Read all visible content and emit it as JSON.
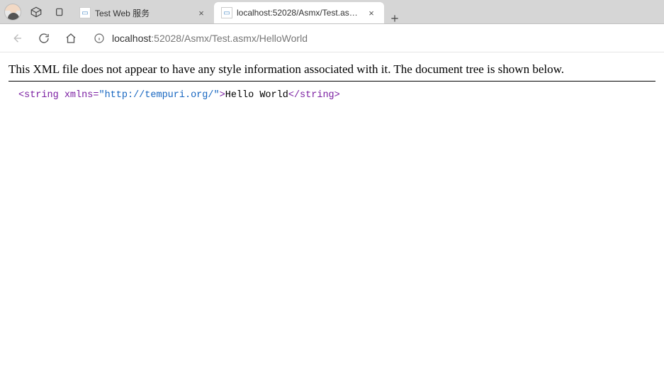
{
  "titlebar": {
    "tabs": [
      {
        "title": "Test Web 服务"
      },
      {
        "title": "localhost:52028/Asmx/Test.asmx/"
      }
    ]
  },
  "toolbar": {
    "url_host": "localhost",
    "url_port_path": ":52028/Asmx/Test.asmx/HelloWorld"
  },
  "page": {
    "banner": "This XML file does not appear to have any style information associated with it. The document tree is shown below.",
    "xml": {
      "open_bracket": "<",
      "tag_name": "string",
      "space": " ",
      "attr_name": "xmlns",
      "eq": "=",
      "quote_open": "\"",
      "attr_value": "http://tempuri.org/",
      "quote_close": "\"",
      "close_open": ">",
      "text": "Hello World",
      "end_open": "</",
      "end_tag": "string",
      "end_close": ">"
    }
  }
}
